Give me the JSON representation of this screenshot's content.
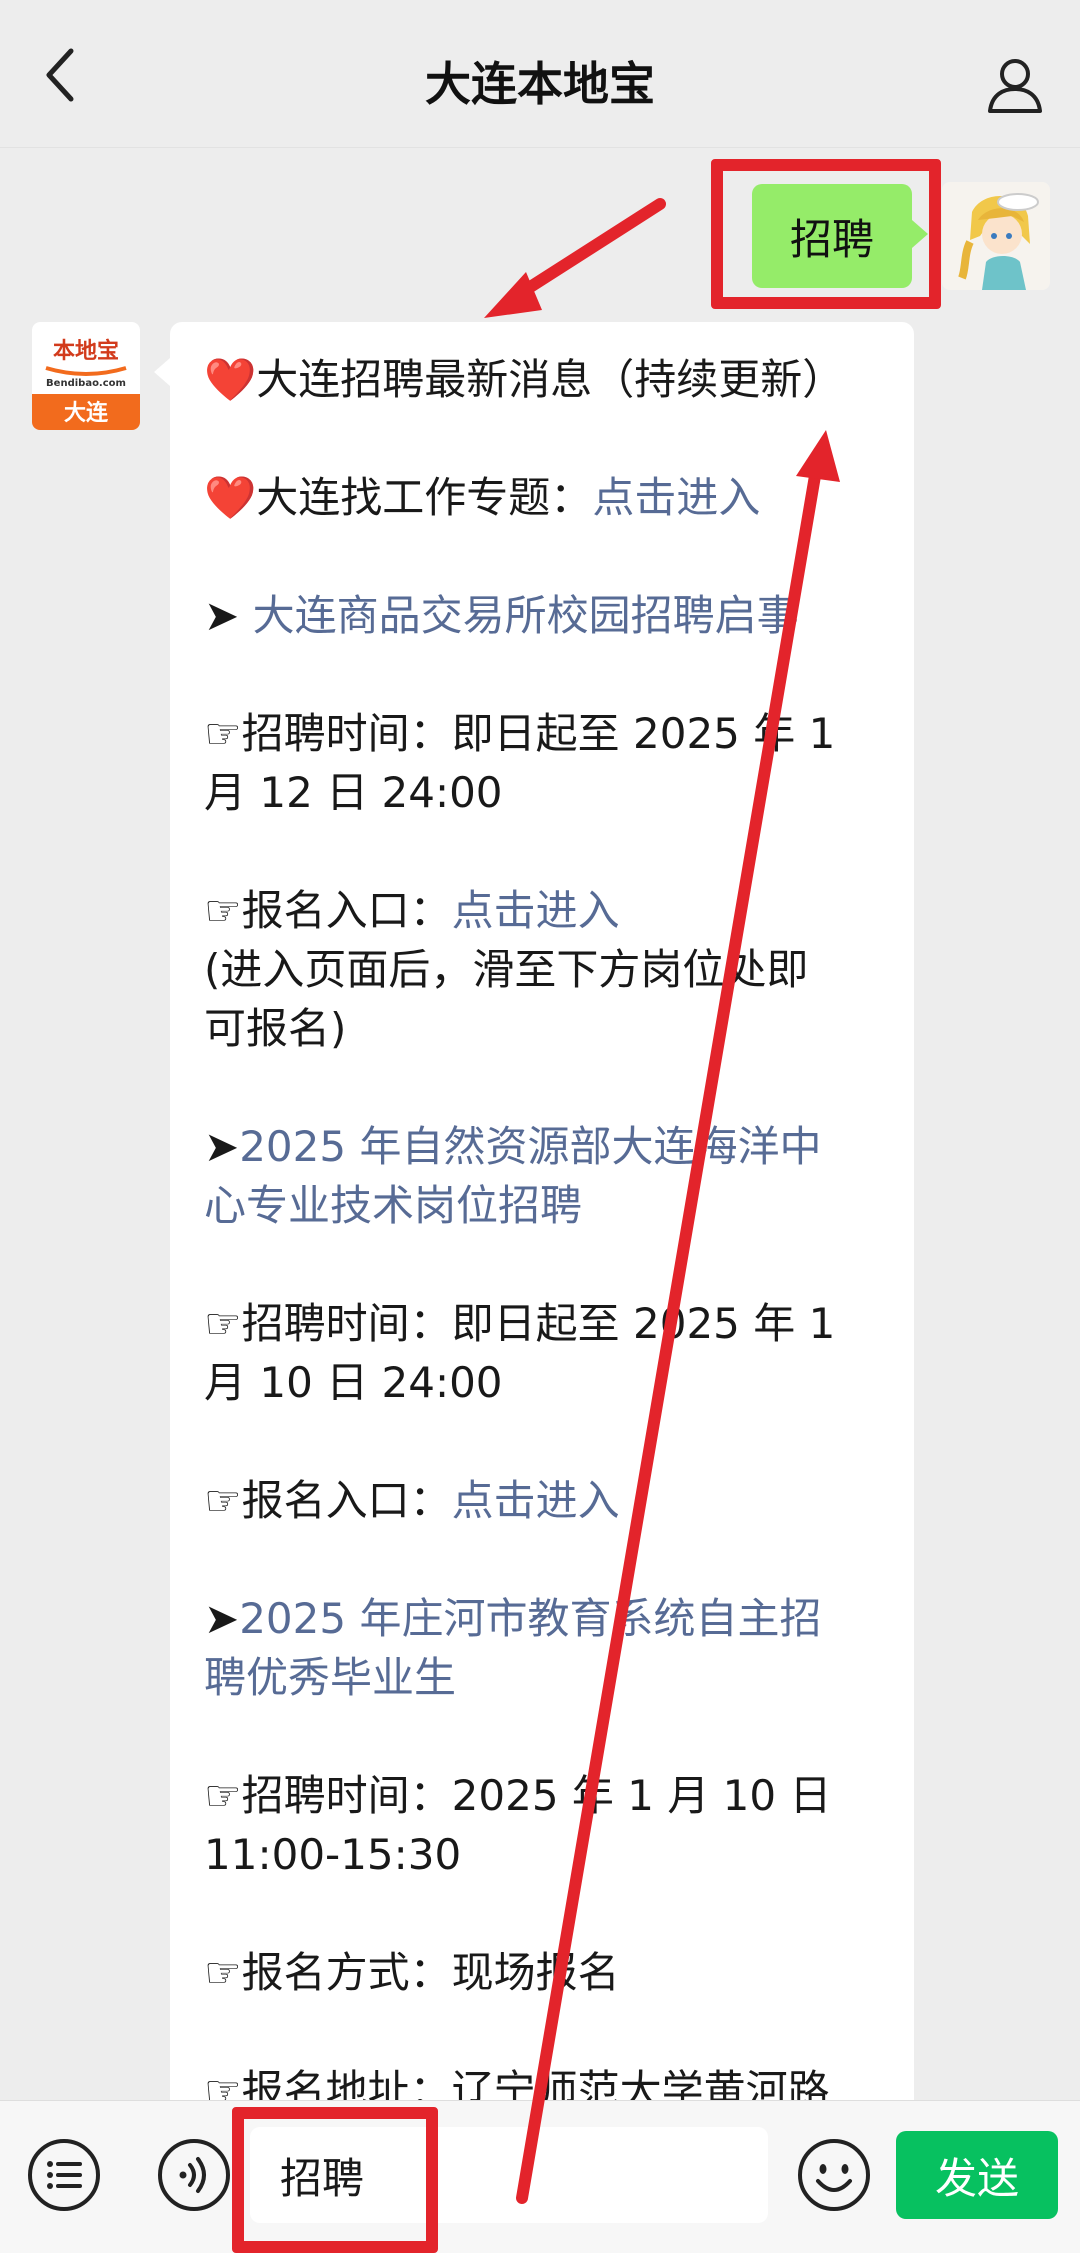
{
  "header": {
    "title": "大连本地宝"
  },
  "icons": {
    "back": "chevron-left-icon",
    "profile": "person-icon",
    "menu": "list-icon",
    "voice": "voice-icon",
    "emoji": "smiley-icon"
  },
  "colors": {
    "user_bubble": "#95ec69",
    "link": "#576b95",
    "send_button": "#07c160",
    "annotation": "#e3242b"
  },
  "user_message": "招聘",
  "bot_avatar": {
    "logo_text": "本地宝",
    "domain_text": "Bendibao.com",
    "city": "大连"
  },
  "bot_message": {
    "line1_heart": "❤️",
    "line1_text": "大连招聘最新消息（持续更新）",
    "line2_heart": "❤️",
    "line2_text": "大连找工作专题：",
    "line2_link": "点击进入",
    "job1": {
      "arrow": "➤",
      "title": "大连商品交易所校园招聘启事",
      "time_icon": "☞",
      "time_line1": "招聘时间：即日起至 2025 年 1",
      "time_line2": "月 12 日 24:00",
      "apply_icon": "☞",
      "apply_label": "报名入口：",
      "apply_link": "点击进入",
      "note_line1": "(进入页面后，滑至下方岗位处即",
      "note_line2": "可报名)"
    },
    "job2": {
      "arrow": "➤",
      "title_line1": "2025 年自然资源部大连海洋中",
      "title_line2": "心专业技术岗位招聘",
      "time_icon": "☞",
      "time_line1": "招聘时间：即日起至 2025 年 1",
      "time_line2": "月 10 日 24:00",
      "apply_icon": "☞",
      "apply_label": "报名入口：",
      "apply_link": "点击进入"
    },
    "job3": {
      "arrow": "➤",
      "title_line1": "2025 年庄河市教育系统自主招",
      "title_line2": "聘优秀毕业生",
      "time_icon": "☞",
      "time_line1": "招聘时间：2025 年 1 月 10 日",
      "time_line2": "11:00-15:30",
      "method_icon": "☞",
      "method_text": "报名方式：现场报名",
      "addr_icon": "☞",
      "addr_text": "报名地址：辽宁师范大学黄河路"
    }
  },
  "input_bar": {
    "value": "招聘",
    "send_label": "发送"
  }
}
